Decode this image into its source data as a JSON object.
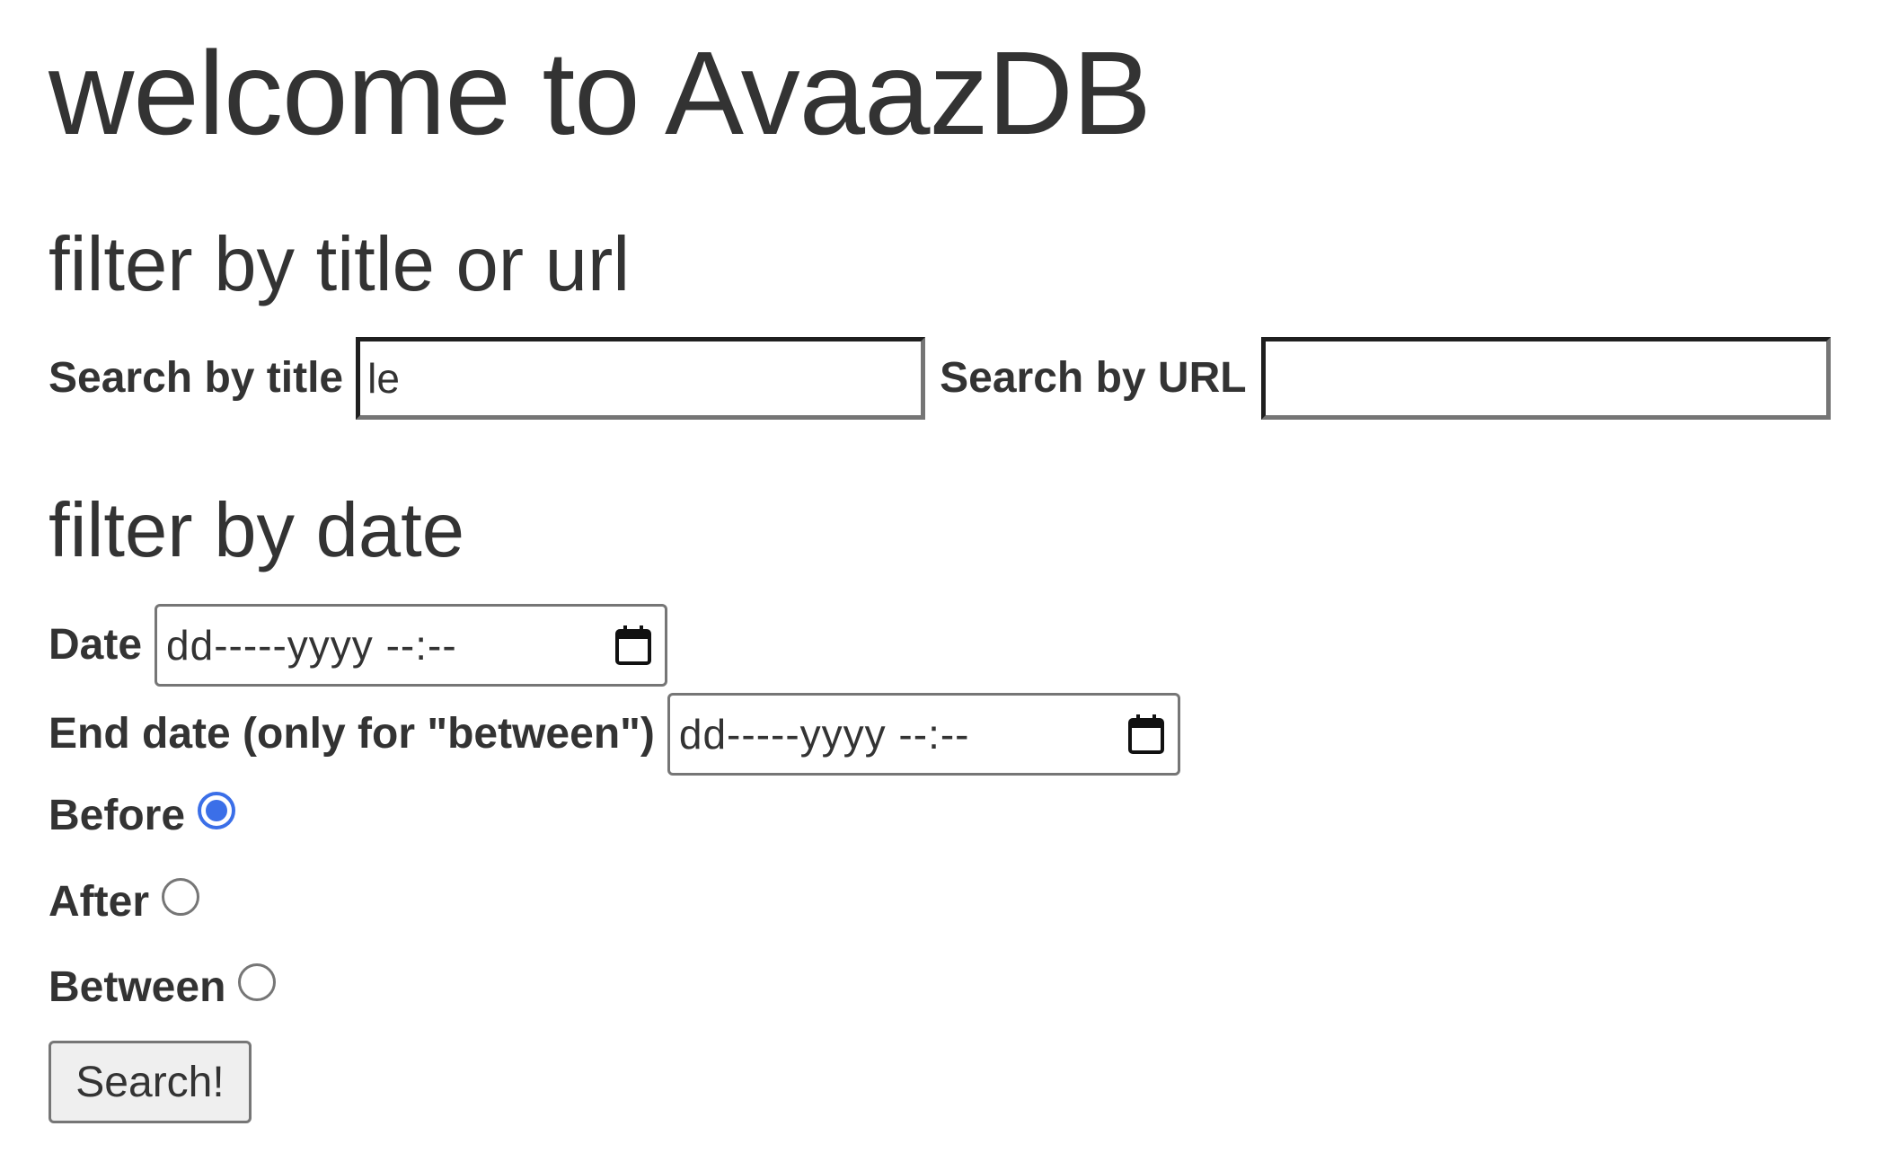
{
  "header": {
    "title": "welcome to AvaazDB"
  },
  "title_url_filter": {
    "heading": "filter by title or url",
    "title_label": "Search by title",
    "title_value": "le",
    "url_label": "Search by URL",
    "url_value": ""
  },
  "date_filter": {
    "heading": "filter by date",
    "date_label": "Date",
    "date_placeholder": "dd-----yyyy --:--",
    "end_date_label": "End date (only for \"between\")",
    "end_date_placeholder": "dd-----yyyy --:--",
    "options": [
      {
        "label": "Before",
        "checked": true
      },
      {
        "label": "After",
        "checked": false
      },
      {
        "label": "Between",
        "checked": false
      }
    ]
  },
  "submit": {
    "label": "Search!"
  },
  "colors": {
    "text": "#333333",
    "radio_accent": "#3b6fe8",
    "button_bg": "#efefef",
    "border_gray": "#767676"
  },
  "icons": {
    "date_picker": "calendar-icon"
  }
}
